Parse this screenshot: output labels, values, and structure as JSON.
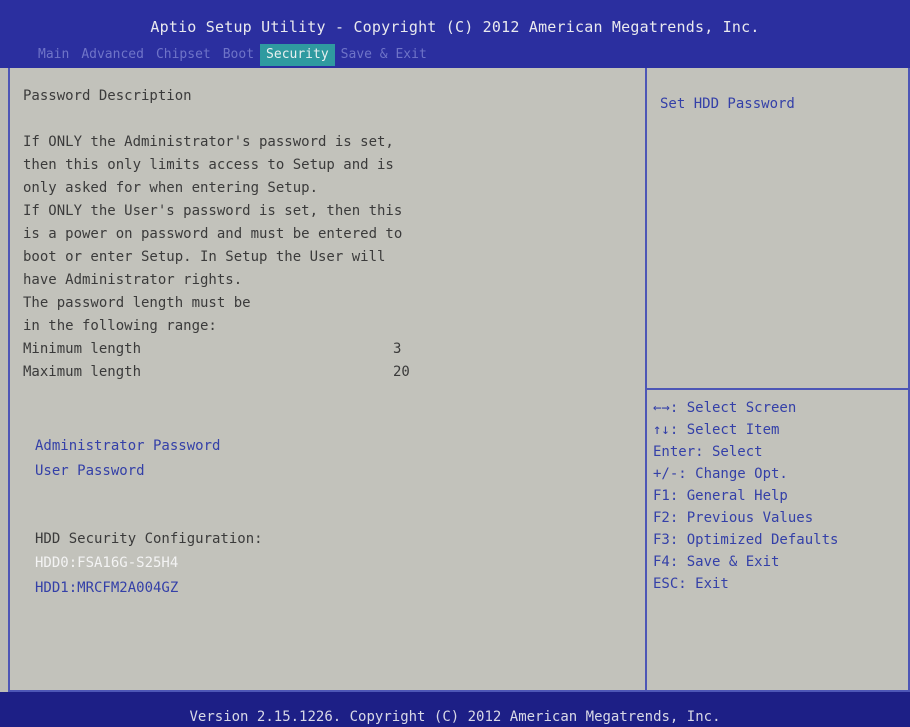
{
  "header": {
    "title": "Aptio Setup Utility - Copyright (C) 2012 American Megatrends, Inc.",
    "tabs": [
      "Main",
      "Advanced",
      "Chipset",
      "Boot",
      "Security",
      "Save & Exit"
    ],
    "active_tab": "Security"
  },
  "left": {
    "section_title": "Password Description",
    "description_lines": [
      "If ONLY the Administrator's password is set,",
      "then this only limits access to Setup and is",
      "only asked for when entering Setup.",
      "If ONLY the User's password is set, then this",
      "is a power on password and must be entered to",
      "boot or enter Setup. In Setup the User will",
      "have Administrator rights.",
      "The password length must be",
      "in the following range:"
    ],
    "min_label": "Minimum length",
    "min_value": "3",
    "max_label": "Maximum length",
    "max_value": "20",
    "admin_password": "Administrator Password",
    "user_password": "User Password",
    "hdd_config_label": "HDD Security Configuration:",
    "hdd0": "HDD0:FSA16G-S25H4",
    "hdd1": "HDD1:MRCFM2A004GZ"
  },
  "right": {
    "help_text": "Set HDD Password",
    "keys": [
      "←→: Select Screen",
      "↑↓: Select Item",
      "Enter: Select",
      "+/-: Change Opt.",
      "F1: General Help",
      "F2: Previous Values",
      "F3: Optimized Defaults",
      "F4: Save & Exit",
      "ESC: Exit"
    ]
  },
  "footer": {
    "text": "Version 2.15.1226. Copyright (C) 2012 American Megatrends, Inc."
  },
  "colors": {
    "header_bg": "#2b2f9f",
    "active_tab_bg": "#2f9aa0",
    "panel_bg": "#c2c2bb",
    "link_text": "#3440a8"
  }
}
